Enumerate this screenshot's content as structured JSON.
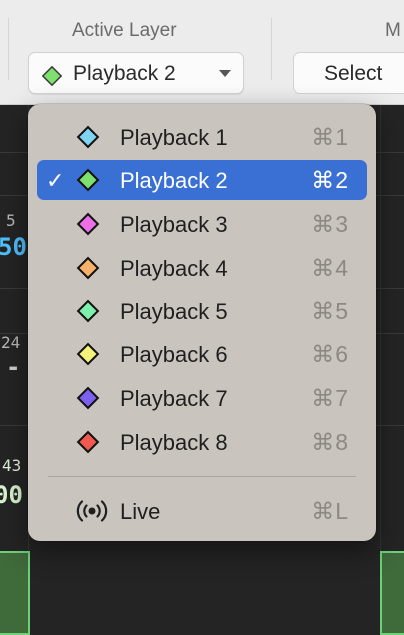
{
  "toolbar": {
    "active_layer_label": "Active Layer",
    "next_label": "M",
    "layer_popup_value": "Playback 2",
    "layer_popup_color": "#7ee06f",
    "select_label": "Select"
  },
  "background": {
    "cells": [
      {
        "num": "5",
        "value": "50",
        "value_color": "#4fc0ff"
      },
      {
        "num": "24",
        "value": "-",
        "value_color": "#cfcfcf"
      },
      {
        "num": "43",
        "value": "00",
        "value_color": "#d8f5d0"
      }
    ]
  },
  "menu": {
    "items": [
      {
        "label": "Playback 1",
        "shortcut": "⌘1",
        "color": "#7fd4f2",
        "selected": false
      },
      {
        "label": "Playback 2",
        "shortcut": "⌘2",
        "color": "#7ee06f",
        "selected": true
      },
      {
        "label": "Playback 3",
        "shortcut": "⌘3",
        "color": "#ec6fe6",
        "selected": false
      },
      {
        "label": "Playback 4",
        "shortcut": "⌘4",
        "color": "#f6b06a",
        "selected": false
      },
      {
        "label": "Playback 5",
        "shortcut": "⌘5",
        "color": "#7ef0ad",
        "selected": false
      },
      {
        "label": "Playback 6",
        "shortcut": "⌘6",
        "color": "#f4f27a",
        "selected": false
      },
      {
        "label": "Playback 7",
        "shortcut": "⌘7",
        "color": "#7c60f0",
        "selected": false
      },
      {
        "label": "Playback 8",
        "shortcut": "⌘8",
        "color": "#f05a4f",
        "selected": false
      }
    ],
    "live": {
      "label": "Live",
      "shortcut": "⌘L",
      "icon": "broadcast-icon"
    },
    "check_glyph": "✓"
  }
}
